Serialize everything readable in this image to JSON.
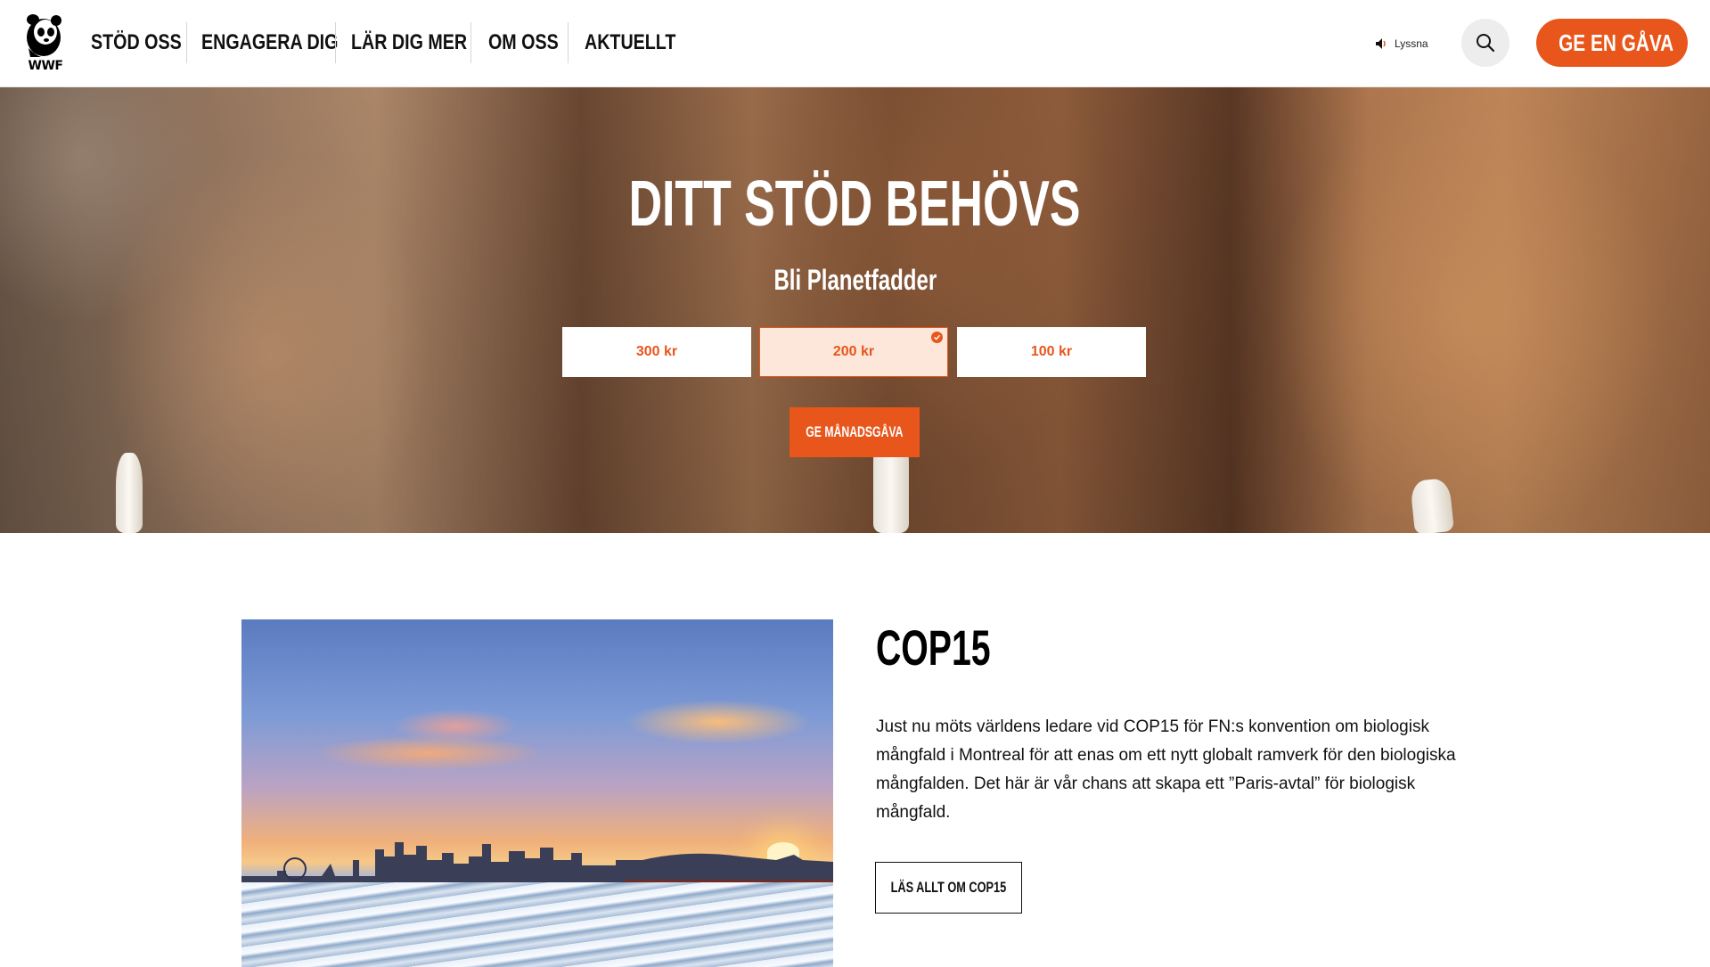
{
  "header": {
    "logo_text": "WWF",
    "nav": [
      {
        "label": "STÖD OSS"
      },
      {
        "label": "ENGAGERA DIG"
      },
      {
        "label": "LÄR DIG MER"
      },
      {
        "label": "OM OSS"
      },
      {
        "label": "AKTUELLT"
      }
    ],
    "listen_label": "Lyssna",
    "search_icon": "search-icon",
    "gift_label": "GE EN GÅVA",
    "gift_icon": "heart-icon"
  },
  "hero": {
    "title": "DITT STÖD BEHÖVS",
    "subtitle": "Bli Planetfadder",
    "amounts": [
      {
        "label": "300 kr",
        "selected": false
      },
      {
        "label": "200 kr",
        "selected": true
      },
      {
        "label": "100 kr",
        "selected": false
      }
    ],
    "cta_label": "GE MÅNADSGÅVA"
  },
  "article": {
    "title": "COP15",
    "body": "Just nu möts världens ledare vid COP15 för FN:s konvention om biologisk mångfald i Montreal för att enas om ett nytt globalt ramverk för den biologiska mångfalden. Det här är vår chans att skapa ett ”Paris-avtal” för biologisk mångfald.",
    "button_label": "LÄS ALLT OM COP15"
  },
  "colors": {
    "accent": "#e8561c",
    "selected_bg": "#fde7da",
    "text": "#111111"
  }
}
